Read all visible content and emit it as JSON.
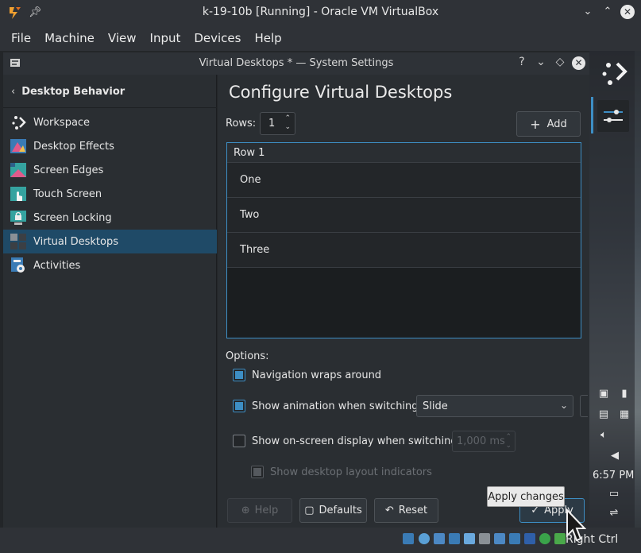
{
  "host": {
    "title": "k-19-10b [Running] - Oracle VM VirtualBox",
    "menu": [
      "File",
      "Machine",
      "View",
      "Input",
      "Devices",
      "Help"
    ],
    "status_right": "Right Ctrl"
  },
  "settings_window": {
    "title": "Virtual Desktops * — System Settings"
  },
  "sidebar": {
    "back_label": "Desktop Behavior",
    "items": [
      {
        "label": "Workspace",
        "icon": "workspace-icon"
      },
      {
        "label": "Desktop Effects",
        "icon": "desktop-effects-icon"
      },
      {
        "label": "Screen Edges",
        "icon": "screen-edges-icon"
      },
      {
        "label": "Touch Screen",
        "icon": "touch-screen-icon"
      },
      {
        "label": "Screen Locking",
        "icon": "screen-locking-icon"
      },
      {
        "label": "Virtual Desktops",
        "icon": "virtual-desktops-icon",
        "selected": true
      },
      {
        "label": "Activities",
        "icon": "activities-icon"
      }
    ]
  },
  "main": {
    "title": "Configure Virtual Desktops",
    "rows_label": "Rows:",
    "rows_value": "1",
    "add_label": "Add",
    "list_header": "Row 1",
    "desktops": [
      "One",
      "Two",
      "Three"
    ],
    "options_label": "Options:",
    "nav_wraps": {
      "label": "Navigation wraps around",
      "checked": true
    },
    "show_animation": {
      "label": "Show animation when switching:",
      "checked": true,
      "value": "Slide"
    },
    "show_osd": {
      "label": "Show on-screen display when switching:",
      "checked": false,
      "value": "1,000 ms"
    },
    "layout_indicators": {
      "label": "Show desktop layout indicators",
      "checked": true,
      "disabled": true
    }
  },
  "buttons": {
    "help": "Help",
    "defaults": "Defaults",
    "reset": "Reset",
    "apply": "Apply",
    "apply_tooltip": "Apply changes"
  },
  "panel": {
    "clock": "6:57 PM"
  },
  "colors": {
    "accent": "#3d8ec4",
    "selection": "#1f4a67"
  }
}
